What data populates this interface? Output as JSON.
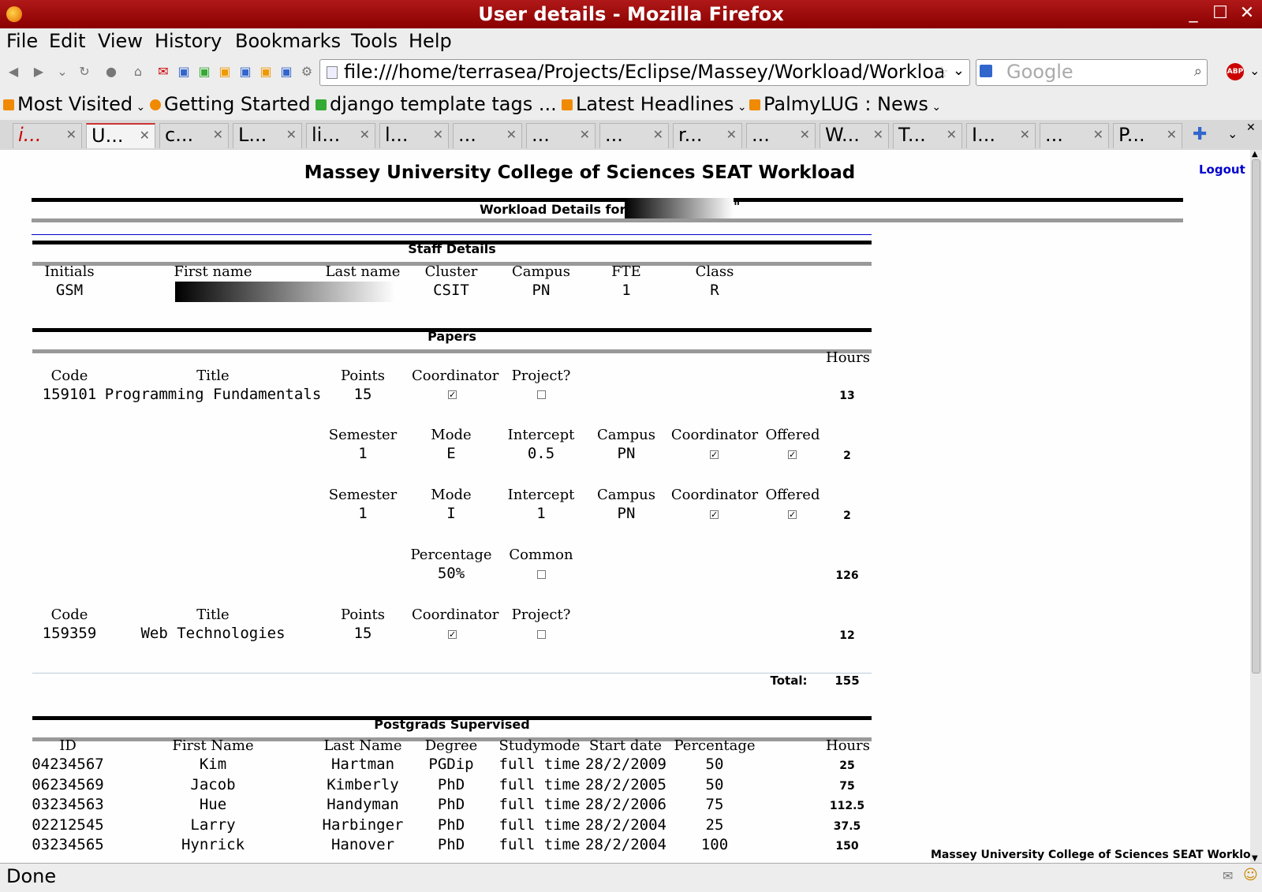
{
  "window": {
    "title": "User details - Mozilla Firefox"
  },
  "menu": [
    "File",
    "Edit",
    "View",
    "History",
    "Bookmarks",
    "Tools",
    "Help"
  ],
  "nav": {
    "url": "file:///home/terrasea/Projects/Eclipse/Massey/Workload/Workload",
    "search_placeholder": "Google"
  },
  "bookmarks": [
    "Most Visited",
    "Getting Started",
    "django template tags ...",
    "Latest Headlines",
    "PalmyLUG : News"
  ],
  "tabs": [
    "i...",
    "U...",
    "c...",
    "L...",
    "li...",
    "l...",
    "...",
    "...",
    "...",
    "r...",
    "...",
    "W...",
    "T...",
    "I...",
    "...",
    "P..."
  ],
  "page": {
    "heading": "Massey University College of Sciences SEAT Workload",
    "logout": "Logout",
    "workload_for": "Workload Details for \"",
    "workload_for_end": "\"",
    "footer": "Massey University College of Sciences SEAT Workload"
  },
  "staff": {
    "title": "Staff Details",
    "headers": [
      "Initials",
      "First name",
      "Last name",
      "Cluster",
      "Campus",
      "FTE",
      "Class"
    ],
    "initials": "GSM",
    "cluster": "CSIT",
    "campus": "PN",
    "fte": "1",
    "class": "R"
  },
  "papers": {
    "title": "Papers",
    "hours_label": "Hours",
    "paper_headers": [
      "Code",
      "Title",
      "Points",
      "Coordinator",
      "Project?"
    ],
    "offering_headers": [
      "Semester",
      "Mode",
      "Intercept",
      "Campus",
      "Coordinator",
      "Offered"
    ],
    "common_headers": [
      "Percentage",
      "Common"
    ],
    "p1": {
      "code": "159101",
      "title": "Programming Fundamentals",
      "points": "15",
      "hours": "13"
    },
    "o1": {
      "semester": "1",
      "mode": "E",
      "intercept": "0.5",
      "campus": "PN",
      "hours": "2"
    },
    "o2": {
      "semester": "1",
      "mode": "I",
      "intercept": "1",
      "campus": "PN",
      "hours": "2"
    },
    "common": {
      "percentage": "50%",
      "hours": "126"
    },
    "p2": {
      "code": "159359",
      "title": "Web Technologies",
      "points": "15",
      "hours": "12"
    },
    "total_label": "Total:",
    "total": "155"
  },
  "postgrads": {
    "title": "Postgrads Supervised",
    "headers": [
      "ID",
      "First Name",
      "Last Name",
      "Degree",
      "Studymode",
      "Start date",
      "Percentage",
      "Hours"
    ],
    "rows": [
      {
        "id": "04234567",
        "first": "Kim",
        "last": "Hartman",
        "degree": "PGDip",
        "mode": "full time",
        "start": "28/2/2009",
        "pct": "50",
        "hours": "25"
      },
      {
        "id": "06234569",
        "first": "Jacob",
        "last": "Kimberly",
        "degree": "PhD",
        "mode": "full time",
        "start": "28/2/2005",
        "pct": "50",
        "hours": "75"
      },
      {
        "id": "03234563",
        "first": "Hue",
        "last": "Handyman",
        "degree": "PhD",
        "mode": "full time",
        "start": "28/2/2006",
        "pct": "75",
        "hours": "112.5"
      },
      {
        "id": "02212545",
        "first": "Larry",
        "last": "Harbinger",
        "degree": "PhD",
        "mode": "full time",
        "start": "28/2/2004",
        "pct": "25",
        "hours": "37.5"
      },
      {
        "id": "03234565",
        "first": "Hynrick",
        "last": "Hanover",
        "degree": "PhD",
        "mode": "full time",
        "start": "28/2/2004",
        "pct": "100",
        "hours": "150"
      }
    ]
  },
  "status": {
    "text": "Done"
  }
}
